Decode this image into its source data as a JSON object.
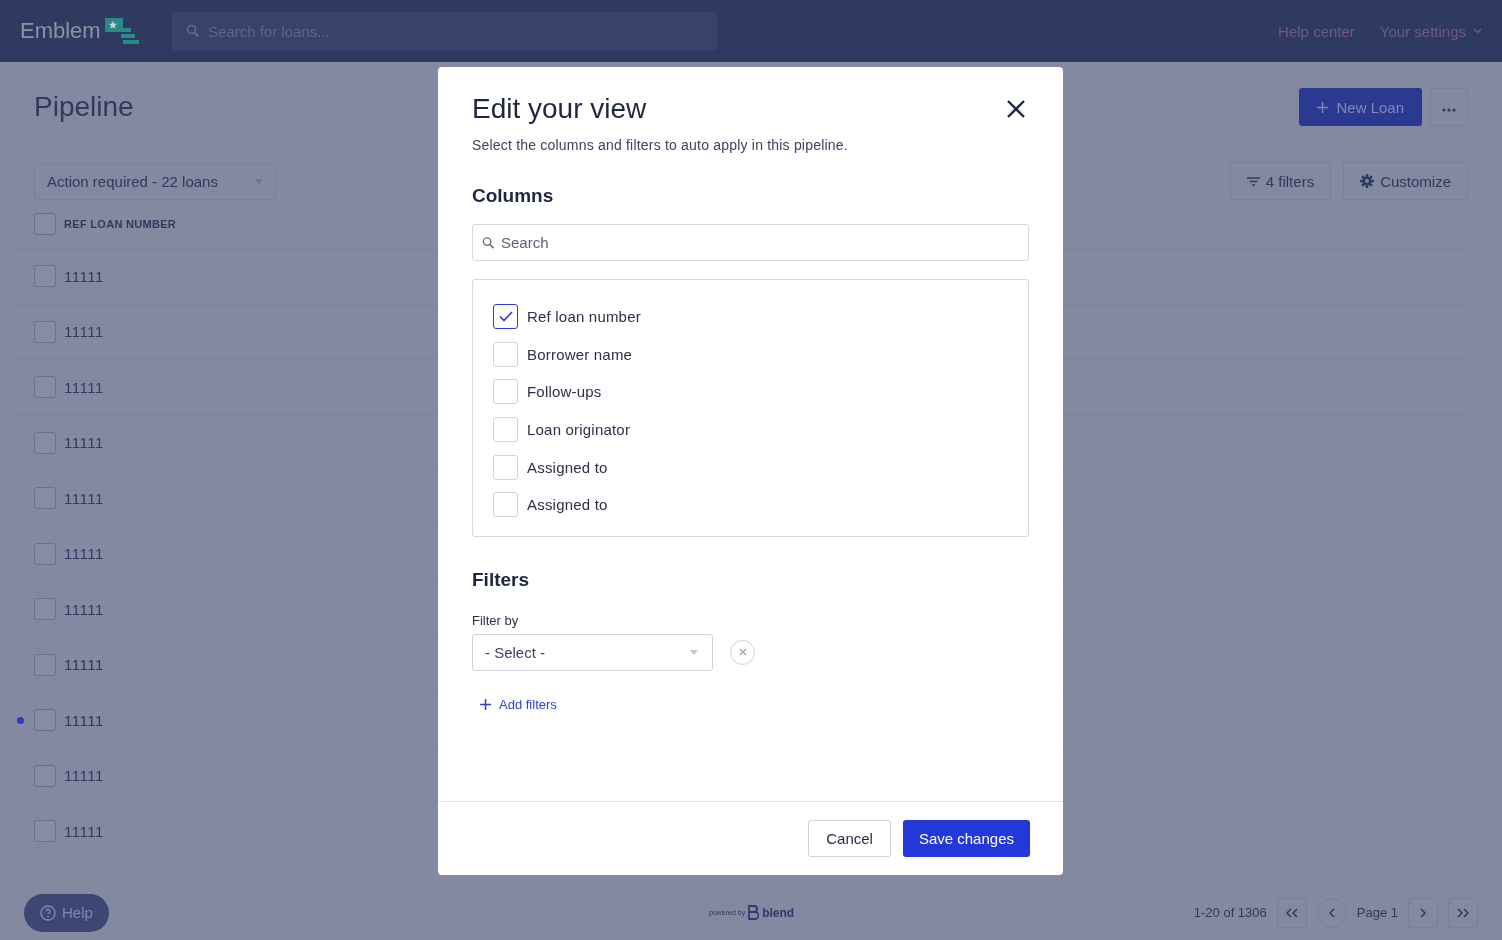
{
  "header": {
    "logo": "Emblem",
    "search": {
      "placeholder": "Search for loans..."
    },
    "links": [
      "Help center",
      "Your settings"
    ]
  },
  "page": {
    "title": "Pipeline",
    "new_button": "New Loan",
    "view_select": "Action required - 22 loans",
    "filters_button": "4 filters",
    "customize_button": "Customize"
  },
  "table": {
    "column": "REF LOAN NUMBER",
    "all_checked": false,
    "rows": [
      {
        "ref": "11111",
        "flagged": false,
        "checked": false
      },
      {
        "ref": "11111",
        "flagged": false,
        "checked": false
      },
      {
        "ref": "11111",
        "flagged": false,
        "checked": false
      },
      {
        "ref": "11111",
        "flagged": false,
        "checked": false
      },
      {
        "ref": "11111",
        "flagged": false,
        "checked": false
      },
      {
        "ref": "11111",
        "flagged": false,
        "checked": false
      },
      {
        "ref": "11111",
        "flagged": false,
        "checked": false
      },
      {
        "ref": "11111",
        "flagged": false,
        "checked": false
      },
      {
        "ref": "11111",
        "flagged": true,
        "checked": false
      },
      {
        "ref": "11111",
        "flagged": false,
        "checked": false
      },
      {
        "ref": "11111",
        "flagged": false,
        "checked": false
      }
    ]
  },
  "footer": {
    "help": "Help",
    "powered_by": "powered by",
    "brand": "blend",
    "range": "1-20 of 1306",
    "page": "Page 1"
  },
  "modal": {
    "title": "Edit your view",
    "subtitle": "Select the columns and filters to auto apply in this pipeline.",
    "columns_heading": "Columns",
    "search": {
      "placeholder": "Search"
    },
    "columns": [
      {
        "label": "Ref loan number",
        "checked": true
      },
      {
        "label": "Borrower name",
        "checked": false
      },
      {
        "label": "Follow-ups",
        "checked": false
      },
      {
        "label": "Loan originator",
        "checked": false
      },
      {
        "label": "Assigned to",
        "checked": false
      },
      {
        "label": "Assigned to",
        "checked": false
      }
    ],
    "filters_heading": "Filters",
    "filter_label": "Filter by",
    "filter_select": "- Select -",
    "add_filters": "Add filters",
    "cancel": "Cancel",
    "save": "Save changes"
  }
}
